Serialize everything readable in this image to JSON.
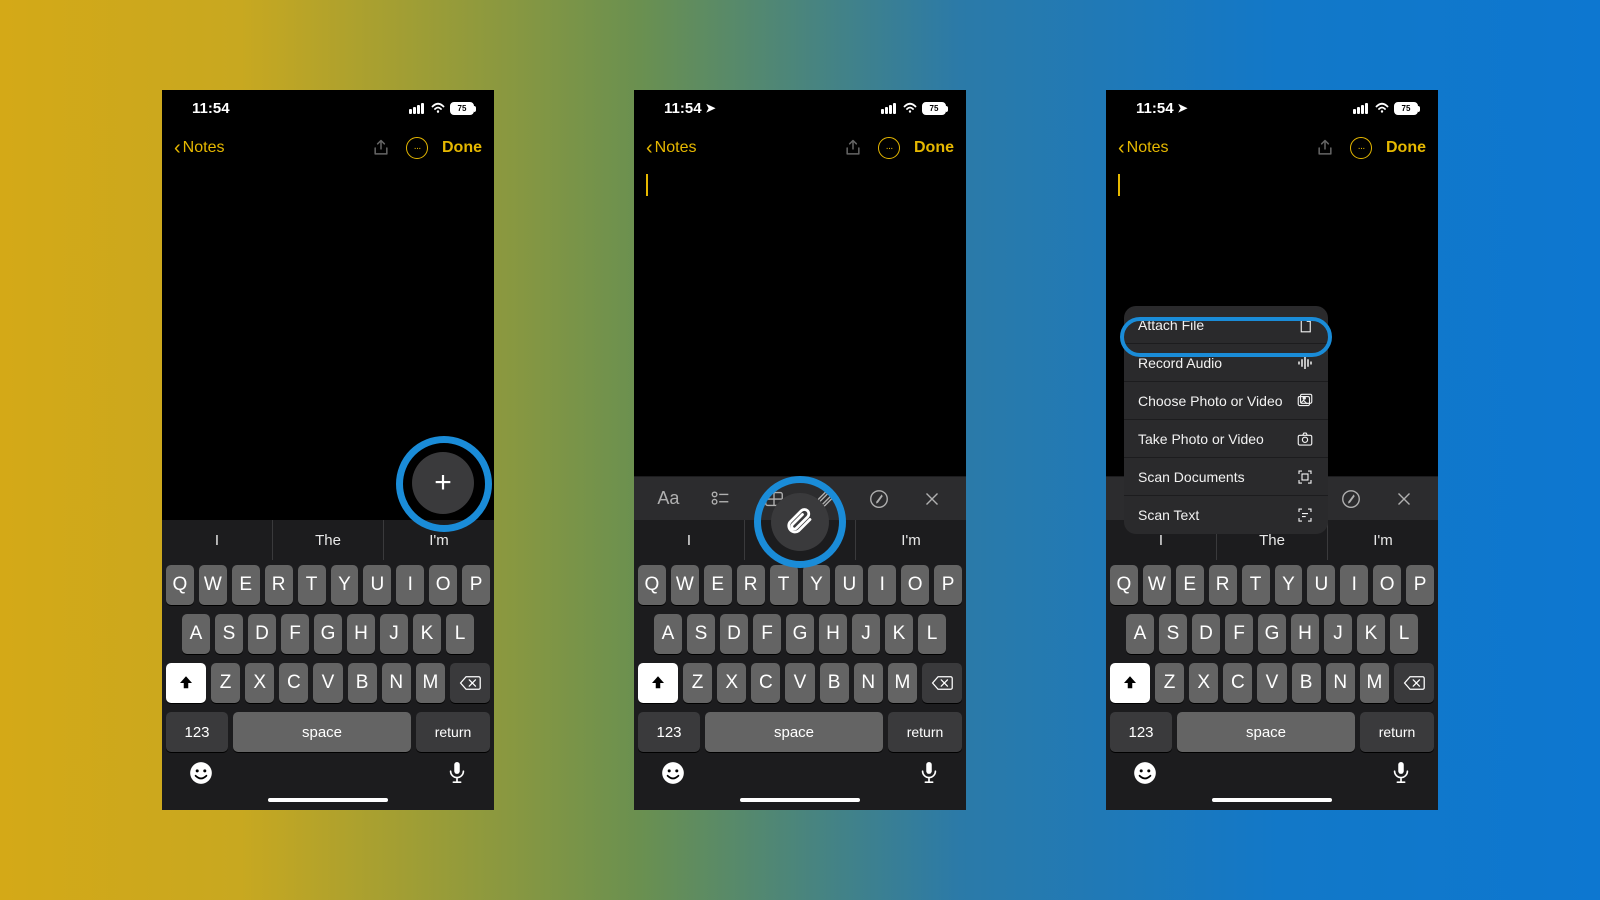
{
  "status": {
    "time": "11:54",
    "battery": "75"
  },
  "nav": {
    "back_label": "Notes",
    "done_label": "Done"
  },
  "suggestions": [
    "I",
    "The",
    "I'm"
  ],
  "keyboard": {
    "row1": [
      "Q",
      "W",
      "E",
      "R",
      "T",
      "Y",
      "U",
      "I",
      "O",
      "P"
    ],
    "row2": [
      "A",
      "S",
      "D",
      "F",
      "G",
      "H",
      "J",
      "K",
      "L"
    ],
    "row3": [
      "Z",
      "X",
      "C",
      "V",
      "B",
      "N",
      "M"
    ],
    "numkey": "123",
    "space": "space",
    "return": "return"
  },
  "menu": {
    "items": [
      {
        "label": "Attach File",
        "icon": "doc"
      },
      {
        "label": "Record Audio",
        "icon": "wave"
      },
      {
        "label": "Choose Photo or Video",
        "icon": "gallery"
      },
      {
        "label": "Take Photo or Video",
        "icon": "camera"
      },
      {
        "label": "Scan Documents",
        "icon": "scan"
      },
      {
        "label": "Scan Text",
        "icon": "text-scan"
      }
    ]
  }
}
